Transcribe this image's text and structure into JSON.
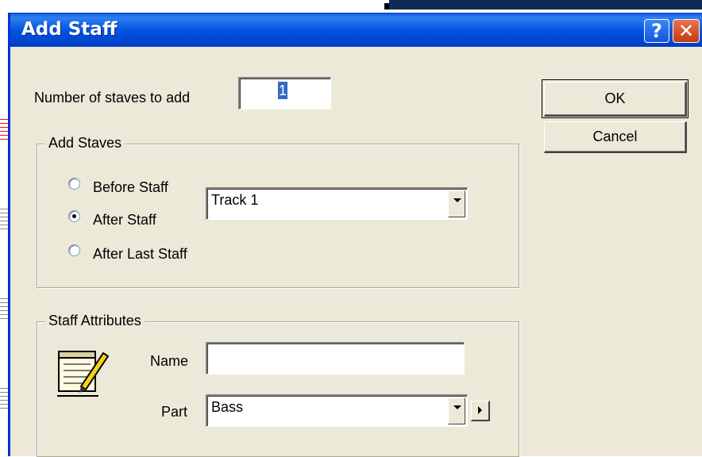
{
  "dialog": {
    "title": "Add Staff",
    "help_symbol": "?",
    "close_symbol": "✕",
    "num_staves_label": "Number of staves to add",
    "num_staves_value": "1",
    "ok_label": "OK",
    "cancel_label": "Cancel"
  },
  "add_staves": {
    "legend": "Add Staves",
    "options": [
      {
        "label": "Before Staff",
        "checked": false
      },
      {
        "label": "After Staff",
        "checked": true
      },
      {
        "label": "After Last Staff",
        "checked": false
      }
    ],
    "track_value": "Track 1"
  },
  "staff_attributes": {
    "legend": "Staff Attributes",
    "icon": "staff-edit-icon",
    "name_label": "Name",
    "name_value": "",
    "part_label": "Part",
    "part_value": "Bass"
  }
}
